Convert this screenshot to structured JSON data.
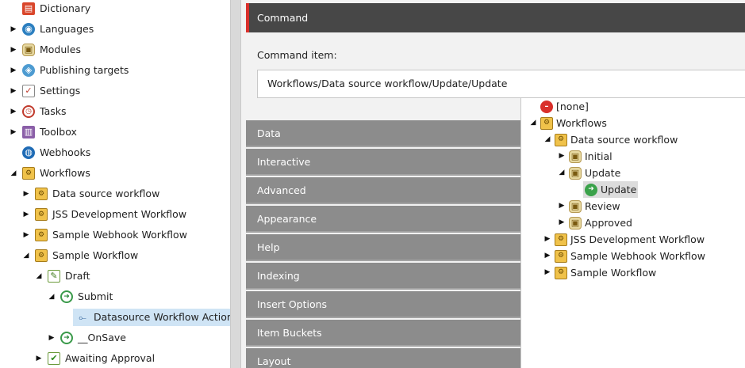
{
  "left_tree": [
    {
      "label": "Dictionary",
      "arrow": "",
      "icon": "dictionary-icon",
      "glyph": "▤"
    },
    {
      "label": "Languages",
      "arrow": "closed",
      "icon": "globe-icon",
      "glyph": "◉"
    },
    {
      "label": "Modules",
      "arrow": "closed",
      "icon": "jar-icon",
      "glyph": "▣"
    },
    {
      "label": "Publishing targets",
      "arrow": "closed",
      "icon": "publish-icon",
      "glyph": "◈"
    },
    {
      "label": "Settings",
      "arrow": "closed",
      "icon": "checklist-icon",
      "glyph": "✓"
    },
    {
      "label": "Tasks",
      "arrow": "closed",
      "icon": "clock-icon",
      "glyph": "◷"
    },
    {
      "label": "Toolbox",
      "arrow": "closed",
      "icon": "toolbox-icon",
      "glyph": "▥"
    },
    {
      "label": "Webhooks",
      "arrow": "",
      "icon": "webhook-globe-icon",
      "glyph": "◍"
    },
    {
      "label": "Workflows",
      "arrow": "open",
      "icon": "workflow-icon",
      "glyph": "⚙"
    },
    {
      "label": "Data source workflow",
      "arrow": "closed",
      "icon": "workflow-icon",
      "glyph": "⚙"
    },
    {
      "label": "JSS Development Workflow",
      "arrow": "closed",
      "icon": "workflow-icon",
      "glyph": "⚙"
    },
    {
      "label": "Sample Webhook Workflow",
      "arrow": "closed",
      "icon": "workflow-icon",
      "glyph": "⚙"
    },
    {
      "label": "Sample Workflow",
      "arrow": "open",
      "icon": "workflow-icon",
      "glyph": "⚙"
    },
    {
      "label": "Draft",
      "arrow": "open",
      "icon": "draft-state-icon",
      "glyph": "✎"
    },
    {
      "label": "Submit",
      "arrow": "open",
      "icon": "command-icon",
      "glyph": "➜"
    },
    {
      "label": "Datasource Workflow Action",
      "arrow": "",
      "icon": "action-icon",
      "glyph": "⟜"
    },
    {
      "label": "__OnSave",
      "arrow": "closed",
      "icon": "command-icon",
      "glyph": "➜"
    },
    {
      "label": "Awaiting Approval",
      "arrow": "closed",
      "icon": "approval-icon",
      "glyph": "✔"
    }
  ],
  "content": {
    "section_title": "Command",
    "field_label": "Command item:",
    "field_value": "Workflows/Data source workflow/Update/Update",
    "sections": [
      "Data",
      "Interactive",
      "Advanced",
      "Appearance",
      "Help",
      "Indexing",
      "Insert Options",
      "Item Buckets",
      "Layout"
    ]
  },
  "popup_tree": [
    {
      "label": "[none]",
      "arrow": "",
      "icon": "none-icon",
      "glyph": "–"
    },
    {
      "label": "Workflows",
      "arrow": "open",
      "icon": "workflow-icon",
      "glyph": "⚙"
    },
    {
      "label": "Data source workflow",
      "arrow": "open",
      "icon": "workflow-icon",
      "glyph": "⚙"
    },
    {
      "label": "Initial",
      "arrow": "closed",
      "icon": "jar-icon",
      "glyph": "▣"
    },
    {
      "label": "Update",
      "arrow": "open",
      "icon": "jar-icon",
      "glyph": "▣"
    },
    {
      "label": "Update",
      "arrow": "",
      "icon": "command-ok-icon",
      "glyph": "➜"
    },
    {
      "label": "Review",
      "arrow": "closed",
      "icon": "jar-icon",
      "glyph": "▣"
    },
    {
      "label": "Approved",
      "arrow": "closed",
      "icon": "jar-icon",
      "glyph": "▣"
    },
    {
      "label": "JSS Development Workflow",
      "arrow": "closed",
      "icon": "workflow-icon",
      "glyph": "⚙"
    },
    {
      "label": "Sample Webhook Workflow",
      "arrow": "closed",
      "icon": "workflow-icon",
      "glyph": "⚙"
    },
    {
      "label": "Sample Workflow",
      "arrow": "closed",
      "icon": "workflow-icon",
      "glyph": "⚙"
    }
  ],
  "colors": {
    "command_bar": "#474747",
    "accent": "#d9302b",
    "section_bar": "#8c8c8c",
    "selection": "#cfe4f5"
  }
}
